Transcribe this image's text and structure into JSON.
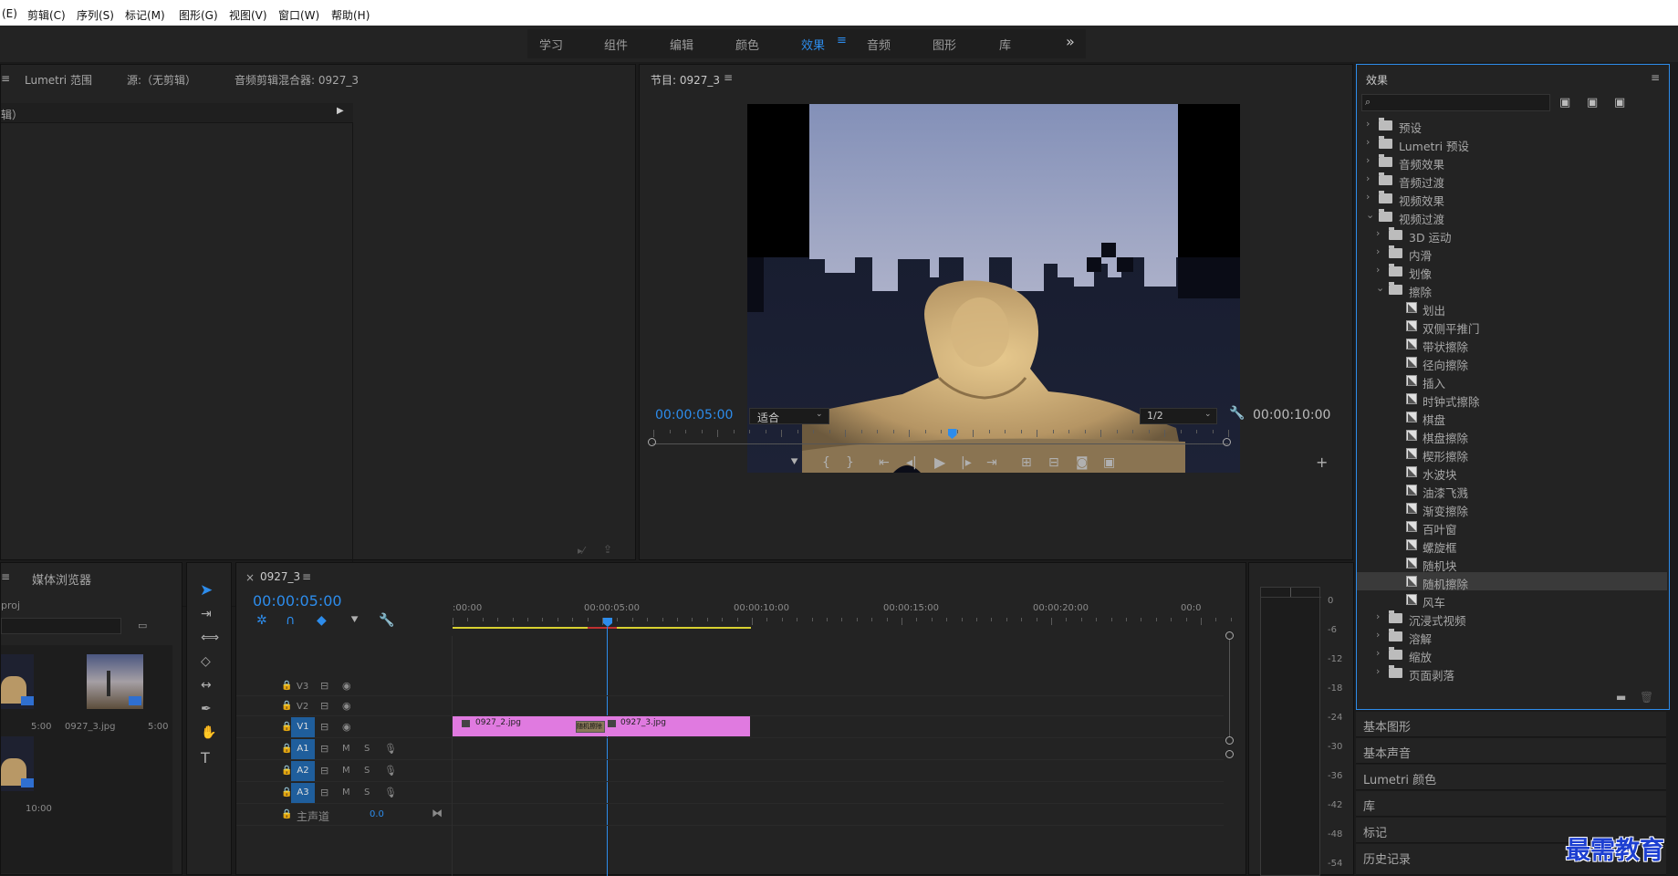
{
  "menu": [
    "(E)",
    "剪辑(C)",
    "序列(S)",
    "标记(M)",
    "图形(G)",
    "视图(V)",
    "窗口(W)",
    "帮助(H)"
  ],
  "workspaces": [
    {
      "label": "学习",
      "active": false
    },
    {
      "label": "组件",
      "active": false
    },
    {
      "label": "编辑",
      "active": false
    },
    {
      "label": "颜色",
      "active": false
    },
    {
      "label": "效果",
      "active": true
    },
    {
      "label": "音频",
      "active": false
    },
    {
      "label": "图形",
      "active": false
    },
    {
      "label": "库",
      "active": false
    }
  ],
  "workspace_more": "»",
  "source_panel": {
    "tabs": [
      "Lumetri 范围",
      "源:（无剪辑）",
      "音频剪辑混合器: 0927_3"
    ],
    "inner_label": "辑）"
  },
  "program_panel": {
    "title": "节目: 0927_3",
    "timecode": "00:00:05:00",
    "fit": "适合",
    "resolution": "1/2",
    "duration": "00:00:10:00",
    "playhead_fraction": 0.5
  },
  "project_panel": {
    "tab": "媒体浏览器",
    "name_label": "proj",
    "items": [
      {
        "name": "",
        "dur": "5:00"
      },
      {
        "name": "0927_3.jpg",
        "dur": "5:00"
      },
      {
        "name": "",
        "dur": "10:00"
      }
    ]
  },
  "timeline": {
    "sequence_name": "0927_3",
    "timecode": "00:00:05:00",
    "ruler": [
      ":00:00",
      "00:00:05:00",
      "00:00:10:00",
      "00:00:15:00",
      "00:00:20:00",
      "00:0"
    ],
    "tracks": [
      "V3",
      "V2",
      "V1",
      "A1",
      "A2",
      "A3"
    ],
    "master_label": "主声道",
    "master_value": "0.0",
    "clips": [
      "0927_2.jpg",
      "0927_3.jpg"
    ],
    "transition": "随机擦除"
  },
  "meter": {
    "ticks": [
      "0",
      "-6",
      "-12",
      "-18",
      "-24",
      "-30",
      "-36",
      "-42",
      "-48",
      "-54"
    ]
  },
  "effects": {
    "title": "效果",
    "search_placeholder": "",
    "tree": [
      {
        "label": "预设",
        "level": 0,
        "kind": "preset",
        "open": false
      },
      {
        "label": "Lumetri 预设",
        "level": 0,
        "kind": "preset",
        "open": false
      },
      {
        "label": "音频效果",
        "level": 0,
        "kind": "folder",
        "open": false
      },
      {
        "label": "音频过渡",
        "level": 0,
        "kind": "folder",
        "open": false
      },
      {
        "label": "视频效果",
        "level": 0,
        "kind": "folder",
        "open": false
      },
      {
        "label": "视频过渡",
        "level": 0,
        "kind": "folder",
        "open": true
      },
      {
        "label": "3D 运动",
        "level": 1,
        "kind": "folder",
        "open": false
      },
      {
        "label": "内滑",
        "level": 1,
        "kind": "folder",
        "open": false
      },
      {
        "label": "划像",
        "level": 1,
        "kind": "folder",
        "open": false
      },
      {
        "label": "擦除",
        "level": 1,
        "kind": "folder",
        "open": true
      },
      {
        "label": "划出",
        "level": 2,
        "kind": "item"
      },
      {
        "label": "双侧平推门",
        "level": 2,
        "kind": "item"
      },
      {
        "label": "带状擦除",
        "level": 2,
        "kind": "item"
      },
      {
        "label": "径向擦除",
        "level": 2,
        "kind": "item"
      },
      {
        "label": "插入",
        "level": 2,
        "kind": "item"
      },
      {
        "label": "时钟式擦除",
        "level": 2,
        "kind": "item"
      },
      {
        "label": "棋盘",
        "level": 2,
        "kind": "item"
      },
      {
        "label": "棋盘擦除",
        "level": 2,
        "kind": "item"
      },
      {
        "label": "楔形擦除",
        "level": 2,
        "kind": "item"
      },
      {
        "label": "水波块",
        "level": 2,
        "kind": "item"
      },
      {
        "label": "油漆飞溅",
        "level": 2,
        "kind": "item"
      },
      {
        "label": "渐变擦除",
        "level": 2,
        "kind": "item"
      },
      {
        "label": "百叶窗",
        "level": 2,
        "kind": "item"
      },
      {
        "label": "螺旋框",
        "level": 2,
        "kind": "item"
      },
      {
        "label": "随机块",
        "level": 2,
        "kind": "item"
      },
      {
        "label": "随机擦除",
        "level": 2,
        "kind": "item",
        "selected": true
      },
      {
        "label": "风车",
        "level": 2,
        "kind": "item"
      },
      {
        "label": "沉浸式视频",
        "level": 1,
        "kind": "folder",
        "open": false
      },
      {
        "label": "溶解",
        "level": 1,
        "kind": "folder",
        "open": false
      },
      {
        "label": "缩放",
        "level": 1,
        "kind": "folder",
        "open": false
      },
      {
        "label": "页面剥落",
        "level": 1,
        "kind": "folder",
        "open": false
      }
    ]
  },
  "side_panels": [
    "基本图形",
    "基本声音",
    "Lumetri 颜色",
    "库",
    "标记",
    "历史记录"
  ],
  "watermark": "最需教育",
  "colors": {
    "accent": "#2d8ceb",
    "clip": "#e07ae0",
    "bg": "#232323"
  }
}
